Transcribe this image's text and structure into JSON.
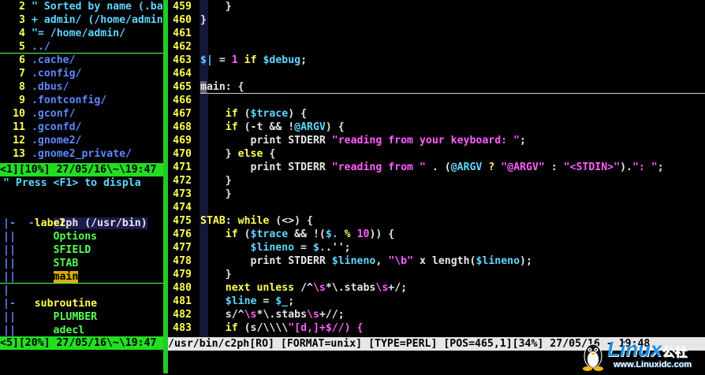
{
  "file_explorer": {
    "lines": [
      {
        "n": "2",
        "text": "\" Sorted by name (.ba"
      },
      {
        "n": "3",
        "text": "+ admin/ (/home/admin"
      },
      {
        "n": "4",
        "text": "\"= /home/admin/"
      },
      {
        "n": "5",
        "text": "../"
      },
      {
        "n": "6",
        "text": ".cache/"
      },
      {
        "n": "7",
        "text": ".config/"
      },
      {
        "n": "8",
        "text": ".dbus/"
      },
      {
        "n": "9",
        "text": ".fontconfig/"
      },
      {
        "n": "10",
        "text": ".gconf/"
      },
      {
        "n": "11",
        "text": ".gconfd/"
      },
      {
        "n": "12",
        "text": ".gnome2/"
      },
      {
        "n": "13",
        "text": ".gnome2_private/"
      }
    ],
    "status": "<1][10%] 27/05/16\\~\\19:47"
  },
  "taglist": {
    "help": "\" Press <F1> to displa",
    "title": "c2ph (/usr/bin)",
    "title_prefix": "-",
    "groups": [
      {
        "prefix": "|-",
        "name": "label",
        "items": [
          "Options",
          "SFIELD",
          "STAB",
          "main"
        ]
      },
      {
        "prefix": "|-",
        "name": "subroutine",
        "items": [
          "PLUMBER",
          "adecl"
        ]
      }
    ],
    "selected_item": "main",
    "status": "<5][20%] 27/05/16\\~\\19:47"
  },
  "code_editor": {
    "lines": [
      {
        "n": "459",
        "text": "    }"
      },
      {
        "n": "460",
        "text": "}"
      },
      {
        "n": "461",
        "text": ""
      },
      {
        "n": "462",
        "text": ""
      },
      {
        "n": "463",
        "text": "$| = 1 if $debug;"
      },
      {
        "n": "464",
        "text": ""
      },
      {
        "n": "465",
        "text": "main: {"
      },
      {
        "n": "466",
        "text": ""
      },
      {
        "n": "467",
        "text": "    if ($trace) {"
      },
      {
        "n": "468",
        "text": "    if (-t && !@ARGV) {"
      },
      {
        "n": "469",
        "text": "        print STDERR \"reading from your keyboard: \";"
      },
      {
        "n": "470",
        "text": "    } else {"
      },
      {
        "n": "471",
        "text": "        print STDERR \"reading from \" . (@ARGV ? \"@ARGV\" : \"<STDIN>\").\": \";"
      },
      {
        "n": "472",
        "text": "    }"
      },
      {
        "n": "473",
        "text": "    }"
      },
      {
        "n": "474",
        "text": ""
      },
      {
        "n": "475",
        "text": "STAB: while (<>) {"
      },
      {
        "n": "476",
        "text": "    if ($trace && !($. % 10)) {"
      },
      {
        "n": "477",
        "text": "        $lineno = $..'';"
      },
      {
        "n": "478",
        "text": "        print STDERR $lineno, \"\\b\" x length($lineno);"
      },
      {
        "n": "479",
        "text": "    }"
      },
      {
        "n": "480",
        "text": "    next unless /^\\s*\\.stabs\\s+/;"
      },
      {
        "n": "481",
        "text": "    $line = $_;"
      },
      {
        "n": "482",
        "text": "    s/^\\s*\\.stabs\\s+//;"
      },
      {
        "n": "483",
        "text": "    if (s/\\\\\\\\\"[d,]+$//) {"
      }
    ],
    "status": "/usr/bin/c2ph[RO] [FORMAT=unix] [TYPE=PERL] [POS=465,1][34%] 27/05/16 - 19:48"
  },
  "watermark": {
    "brand": "Linux",
    "brand_suffix": "公社",
    "url": "www.Linuxidc.com"
  }
}
